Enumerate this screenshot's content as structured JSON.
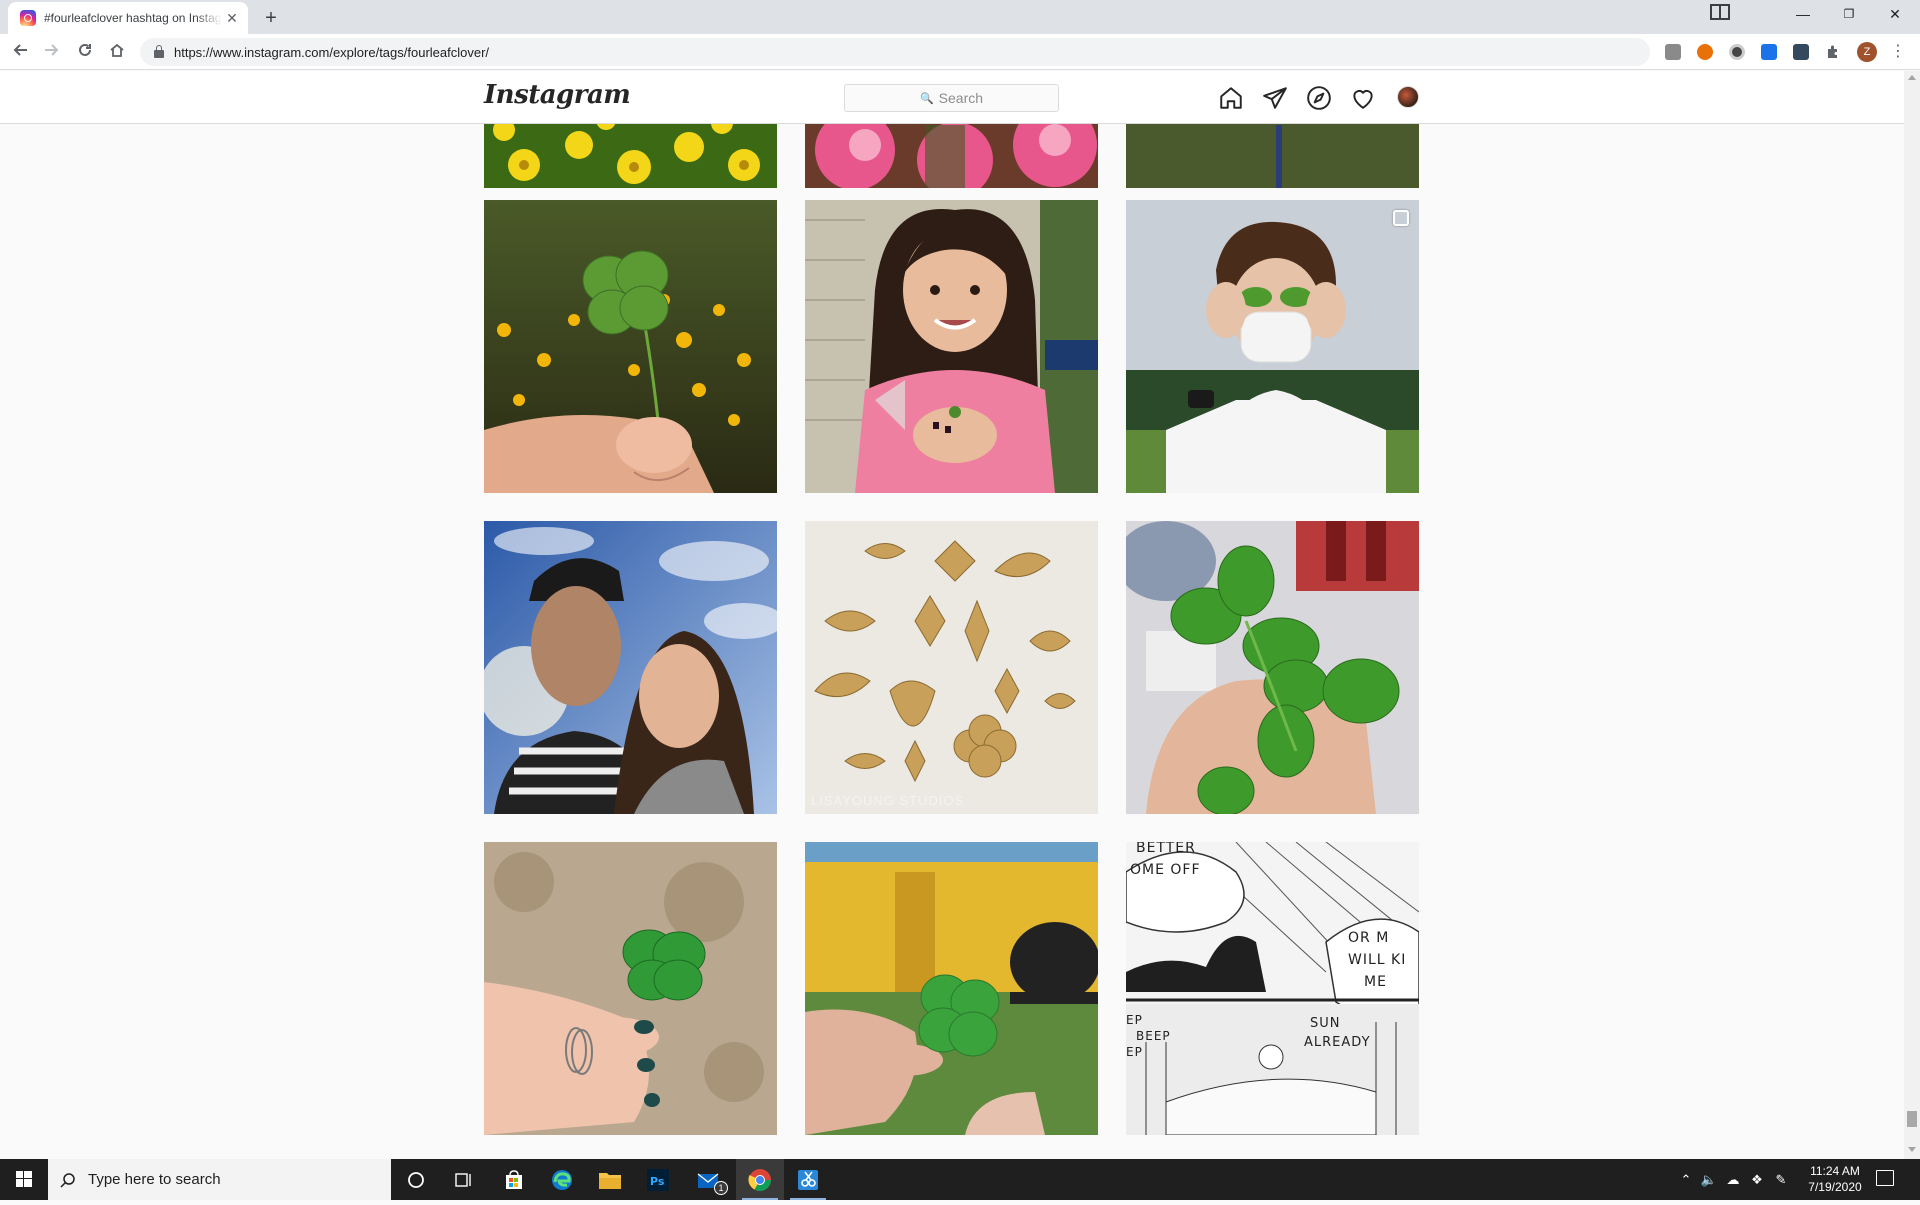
{
  "browser": {
    "tab_title": "#fourleafclover hashtag on Instagram",
    "tab_close": "✕",
    "new_tab": "+",
    "url": "https://www.instagram.com/explore/tags/fourleafclover/",
    "profile_initial": "Z",
    "window_controls": {
      "minimize": "—",
      "maximize": "❐",
      "close": "✕"
    }
  },
  "instagram": {
    "logo": "Instagram",
    "search_placeholder": "Search",
    "nav_icons": [
      "home-icon",
      "direct-message-icon",
      "explore-icon",
      "activity-heart-icon",
      "profile-avatar"
    ]
  },
  "posts": [
    {
      "row": 0,
      "col": 0,
      "subject": "yellow flowers (partially visible)"
    },
    {
      "row": 0,
      "col": 1,
      "subject": "pink flowers (partially visible)"
    },
    {
      "row": 0,
      "col": 2,
      "subject": "dark garden photo (partially visible)"
    },
    {
      "row": 1,
      "col": 0,
      "subject": "hand holding four leaf clover over yellow flowers"
    },
    {
      "row": 1,
      "col": 1,
      "subject": "smiling girl in pink holding a clover"
    },
    {
      "row": 1,
      "col": 2,
      "subject": "person in mask holding clovers over eyes",
      "multi": true
    },
    {
      "row": 2,
      "col": 0,
      "subject": "selfie of a man and a woman under blue sky"
    },
    {
      "row": 2,
      "col": 1,
      "subject": "gold charms on white fabric",
      "watermark": "LISAYOUNG STUDIOS"
    },
    {
      "row": 2,
      "col": 2,
      "subject": "hand holding large green clover"
    },
    {
      "row": 3,
      "col": 0,
      "subject": "hand with teal nails and rings holding clover"
    },
    {
      "row": 3,
      "col": 1,
      "subject": "fingers holding clover in backyard"
    },
    {
      "row": 3,
      "col": 2,
      "subject": "black and white comic panel"
    }
  ],
  "comic": {
    "bubble1": "BETTER\nOME OFF",
    "bubble2": "OR M\nWILL KI\nME",
    "sound": "EP\nBEEP\nEP",
    "sun": "SUN\nALREADY"
  },
  "taskbar": {
    "search_placeholder": "Type here to search",
    "mail_badge": "1",
    "time": "11:24 AM",
    "date": "7/19/2020"
  }
}
